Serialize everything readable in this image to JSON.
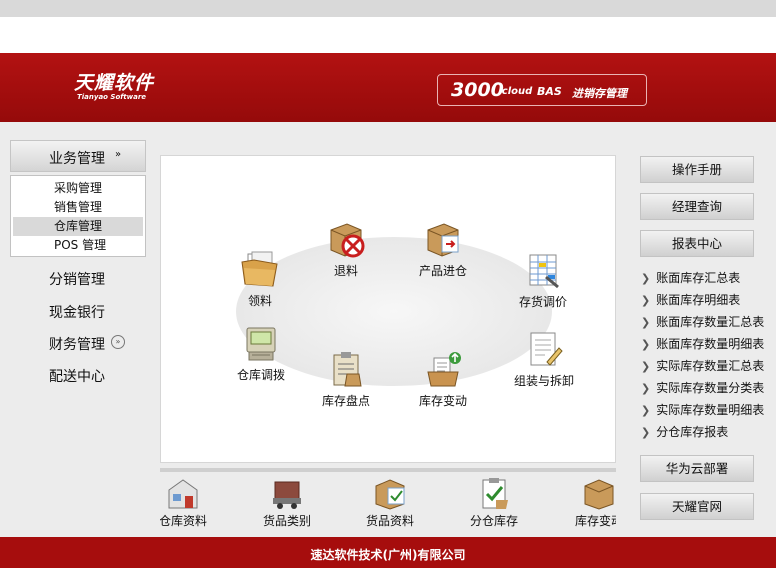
{
  "header": {
    "logo_cn": "天耀软件",
    "logo_en": "Tianyao Software",
    "product": {
      "num": "3000",
      "cloud": ".cloud",
      "bas": "BAS",
      "desc": "进销存管理"
    }
  },
  "leftnav": {
    "section_label": "业务管理",
    "section_icon": "chevron-double-down-icon",
    "subitems": [
      "采购管理",
      "销售管理",
      "仓库管理",
      "POS 管理"
    ],
    "selected": "仓库管理",
    "items": [
      "分销管理",
      "现金银行",
      "财务管理",
      "配送中心"
    ]
  },
  "workflow": {
    "items": [
      {
        "label": "领料",
        "icon": "folder-documents-icon"
      },
      {
        "label": "退料",
        "icon": "box-cancel-icon"
      },
      {
        "label": "产品进仓",
        "icon": "box-arrow-in-icon"
      },
      {
        "label": "存货调价",
        "icon": "spreadsheet-price-icon"
      },
      {
        "label": "仓库调拨",
        "icon": "transfer-machine-icon"
      },
      {
        "label": "库存盘点",
        "icon": "clipboard-count-icon"
      },
      {
        "label": "库存变动",
        "icon": "tray-update-icon"
      },
      {
        "label": "组装与拆卸",
        "icon": "document-pen-icon"
      }
    ]
  },
  "bottombar": {
    "items": [
      {
        "label": "仓库资料",
        "icon": "warehouse-icon"
      },
      {
        "label": "货品类别",
        "icon": "truck-icon"
      },
      {
        "label": "货品资料",
        "icon": "box-check-icon"
      },
      {
        "label": "分仓库存",
        "icon": "clipboard-check-icon"
      },
      {
        "label": "库存变动",
        "icon": "box-arrow-icon"
      }
    ]
  },
  "rightpanel": {
    "buttons": [
      "操作手册",
      "经理查询",
      "报表中心"
    ],
    "links": [
      "账面库存汇总表",
      "账面库存明细表",
      "账面库存数量汇总表",
      "账面库存数量明细表",
      "实际库存数量汇总表",
      "实际库存数量分类表",
      "实际库存数量明细表",
      "分仓库存报表"
    ],
    "bottom_buttons": [
      "华为云部署",
      "天耀官网"
    ]
  },
  "footer": {
    "company": "速达软件技术(广州)有限公司"
  },
  "colors": {
    "brand_red": "#a30d0d",
    "selected_bg": "#d9d9d9"
  }
}
